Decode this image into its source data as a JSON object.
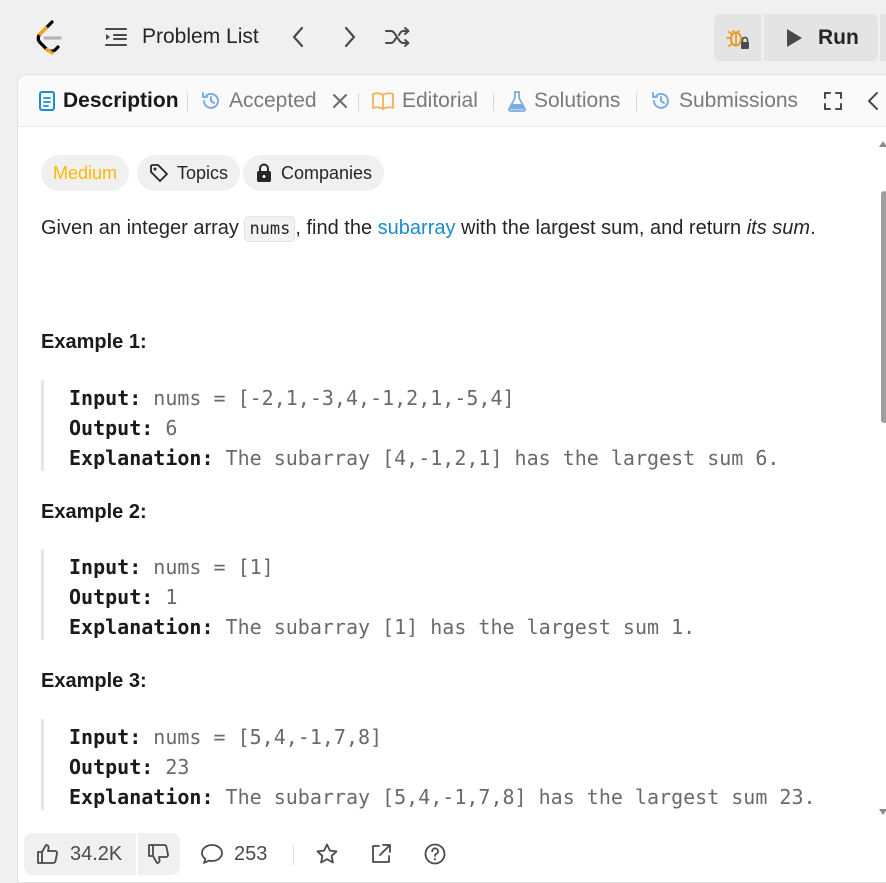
{
  "topbar": {
    "problem_list_label": "Problem List",
    "run_label": "Run"
  },
  "tabs": [
    {
      "label": "Description",
      "active": true
    },
    {
      "label": "Accepted",
      "active": false
    },
    {
      "label": "Editorial",
      "active": false
    },
    {
      "label": "Solutions",
      "active": false
    },
    {
      "label": "Submissions",
      "active": false
    }
  ],
  "badges": {
    "difficulty": "Medium",
    "topics": "Topics",
    "companies": "Companies"
  },
  "description": {
    "part1": "Given an integer array ",
    "code": "nums",
    "part2": ", find the ",
    "link": "subarray",
    "part3": " with the largest sum, and return ",
    "emph": "its sum",
    "part4": "."
  },
  "examples": [
    {
      "title": "Example 1:",
      "input_label": "Input:",
      "input": "nums = [-2,1,-3,4,-1,2,1,-5,4]",
      "output_label": "Output:",
      "output": "6",
      "explanation_label": "Explanation:",
      "explanation": "The subarray [4,-1,2,1] has the largest sum 6."
    },
    {
      "title": "Example 2:",
      "input_label": "Input:",
      "input": "nums = [1]",
      "output_label": "Output:",
      "output": "1",
      "explanation_label": "Explanation:",
      "explanation": "The subarray [1] has the largest sum 1."
    },
    {
      "title": "Example 3:",
      "input_label": "Input:",
      "input": "nums = [5,4,-1,7,8]",
      "output_label": "Output:",
      "output": "23",
      "explanation_label": "Explanation:",
      "explanation": "The subarray [5,4,-1,7,8] has the largest sum 23."
    }
  ],
  "footer": {
    "likes": "34.2K",
    "comments": "253"
  },
  "colors": {
    "accent_link": "#1a8cd0",
    "medium": "#ffb800",
    "logo_orange": "#ffa116"
  }
}
